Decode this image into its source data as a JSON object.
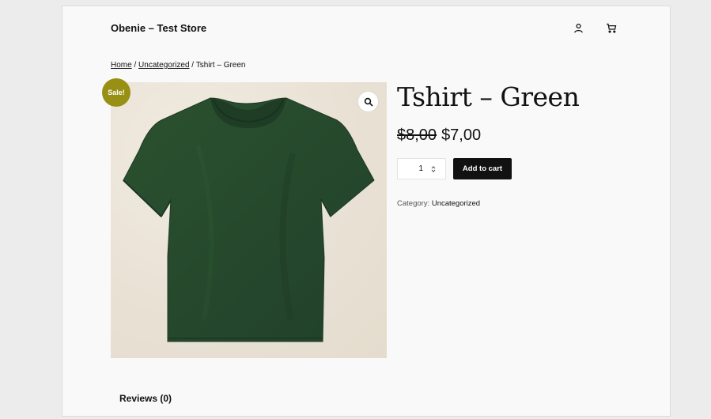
{
  "site": {
    "title": "Obenie – Test Store"
  },
  "header": {
    "account_icon": "user-icon",
    "cart_icon": "cart-icon"
  },
  "breadcrumb": {
    "home": "Home",
    "separator": "/",
    "category": "Uncategorized",
    "current": "Tshirt – Green"
  },
  "product": {
    "title": "Tshirt – Green",
    "price_old": "$8,00",
    "price_new": "$7,00",
    "sale_badge": "Sale!",
    "quantity": "1",
    "add_to_cart": "Add to cart",
    "category_label": "Category:",
    "category_value": "Uncategorized",
    "image_icon": "t-shirt-image",
    "zoom_icon": "magnifier-icon"
  },
  "tabs": [
    {
      "label": "Reviews (0)"
    }
  ],
  "colors": {
    "badge": "#979014",
    "button": "#111111",
    "shirt": "#274a2c",
    "image_bg": "#ebe4d8"
  }
}
